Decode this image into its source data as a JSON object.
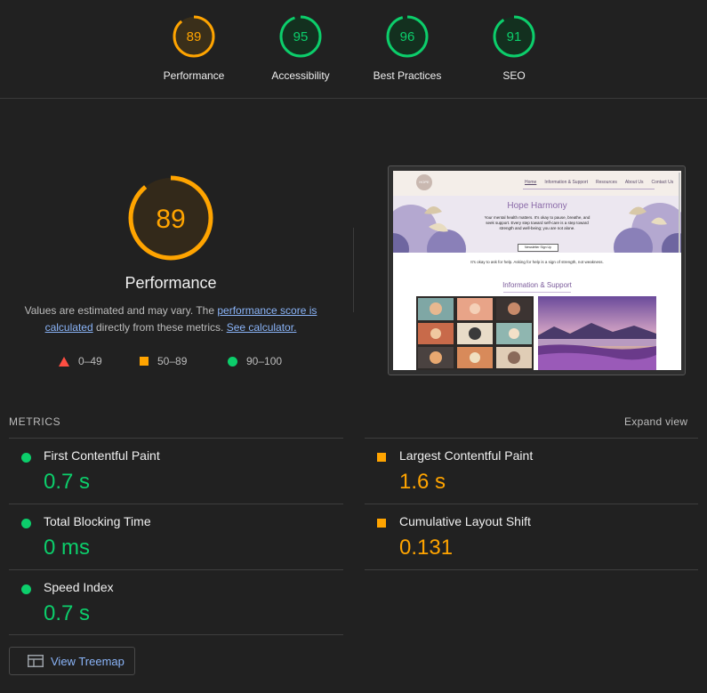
{
  "summary": {
    "gauges": [
      {
        "score": "89",
        "label": "Performance",
        "status": "average",
        "fraction": 0.89
      },
      {
        "score": "95",
        "label": "Accessibility",
        "status": "pass",
        "fraction": 0.95
      },
      {
        "score": "96",
        "label": "Best Practices",
        "status": "pass",
        "fraction": 0.96
      },
      {
        "score": "91",
        "label": "SEO",
        "status": "pass",
        "fraction": 0.91
      }
    ]
  },
  "performance": {
    "score": "89",
    "fraction": 0.89,
    "title": "Performance",
    "desc_prefix": "Values are estimated and may vary. The ",
    "desc_link": "performance score is calculated",
    "desc_middle": " directly from these metrics. ",
    "desc_calc_link": "See calculator.",
    "legend": {
      "fail": "0–49",
      "average": "50–89",
      "pass": "90–100"
    }
  },
  "screenshot": {
    "logo_text": "HOPE",
    "nav": [
      "Home",
      "Information & Support",
      "Resources",
      "About Us",
      "Contact Us"
    ],
    "hero_title": "Hope Harmony",
    "hero_text": "Your mental health matters. It's okay to pause, breathe, and seek support. Every step toward self-care is a step toward strength and well-being; you are not alone.",
    "hero_button": "Newsletter Sign Up",
    "tagline": "It's okay to ask for help. Asking for help is a sign of strength, not weakness.",
    "section_title": "Information & Support"
  },
  "metrics": {
    "header": "METRICS",
    "expand": "Expand view",
    "items": [
      {
        "name": "First Contentful Paint",
        "value": "0.7 s",
        "status": "pass"
      },
      {
        "name": "Largest Contentful Paint",
        "value": "1.6 s",
        "status": "average"
      },
      {
        "name": "Total Blocking Time",
        "value": "0 ms",
        "status": "pass"
      },
      {
        "name": "Cumulative Layout Shift",
        "value": "0.131",
        "status": "average"
      },
      {
        "name": "Speed Index",
        "value": "0.7 s",
        "status": "pass"
      }
    ]
  },
  "treemap": {
    "label": "View Treemap"
  },
  "colors": {
    "pass": "#0cce6b",
    "average": "#ffa400",
    "fail": "#ff4e42",
    "background": "#212121",
    "link": "#8ab4f8"
  }
}
